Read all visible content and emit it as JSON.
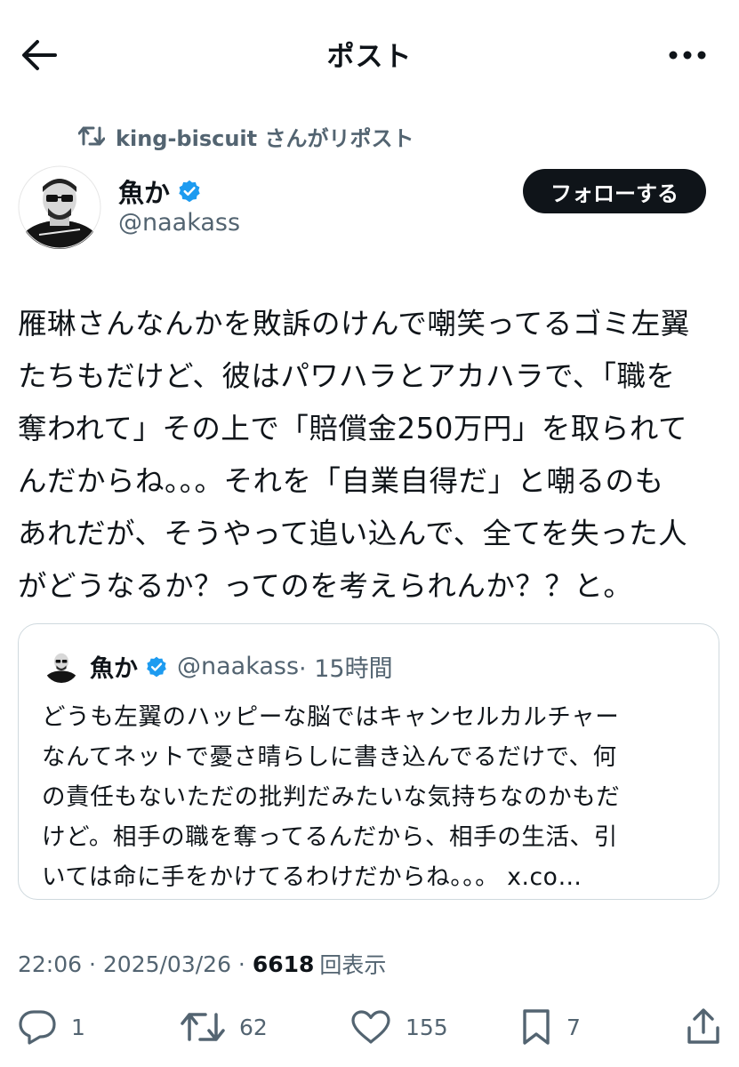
{
  "header": {
    "title": "ポスト"
  },
  "repost": {
    "text": "king-biscuit さんがリポスト"
  },
  "author": {
    "name": "魚か",
    "handle": "@naakass",
    "follow_label": "フォローする"
  },
  "tweet": {
    "text": "雁琳さんなんかを敗訴のけんで嘲笑ってるゴミ左翼\nたちもだけど、彼はパワハラとアカハラで、「職を\n奪われて」その上で「賠償金250万円」を取られて\nんだからね。。。それを「自業自得だ」と嘲るのも\nあれだが、そうやって追い込んで、全てを失った人\nがどうなるか？ってのを考えられんか？？と。"
  },
  "quote": {
    "name": "魚か",
    "handle": "@naakass",
    "time": "· 15時間",
    "text": "どうも左翼のハッピーな脳ではキャンセルカルチャー\nなんてネットで憂さ晴らしに書き込んでるだけで、何\nの責任もないただの批判だみたいな気持ちなのかもだ\nけど。相手の職を奪ってるんだから、相手の生活、引\nいては命に手をかけてるわけだからね。。。 x.co…"
  },
  "meta": {
    "time": "22:06",
    "sep1": " · ",
    "date": "2025/03/26",
    "sep2": " · ",
    "views": "6618",
    "views_label": "回表示"
  },
  "actions": {
    "replies": "1",
    "reposts": "62",
    "likes": "155",
    "bookmarks": "7"
  },
  "colors": {
    "text": "#0f1419",
    "secondary": "#536471",
    "verified": "#1d9bf0",
    "border": "#cfd9de",
    "button_bg": "#0f1419"
  },
  "icons": [
    "back-arrow-icon",
    "more-icon",
    "repost-icon",
    "verified-icon",
    "reply-icon",
    "like-icon",
    "bookmark-icon",
    "share-icon"
  ]
}
